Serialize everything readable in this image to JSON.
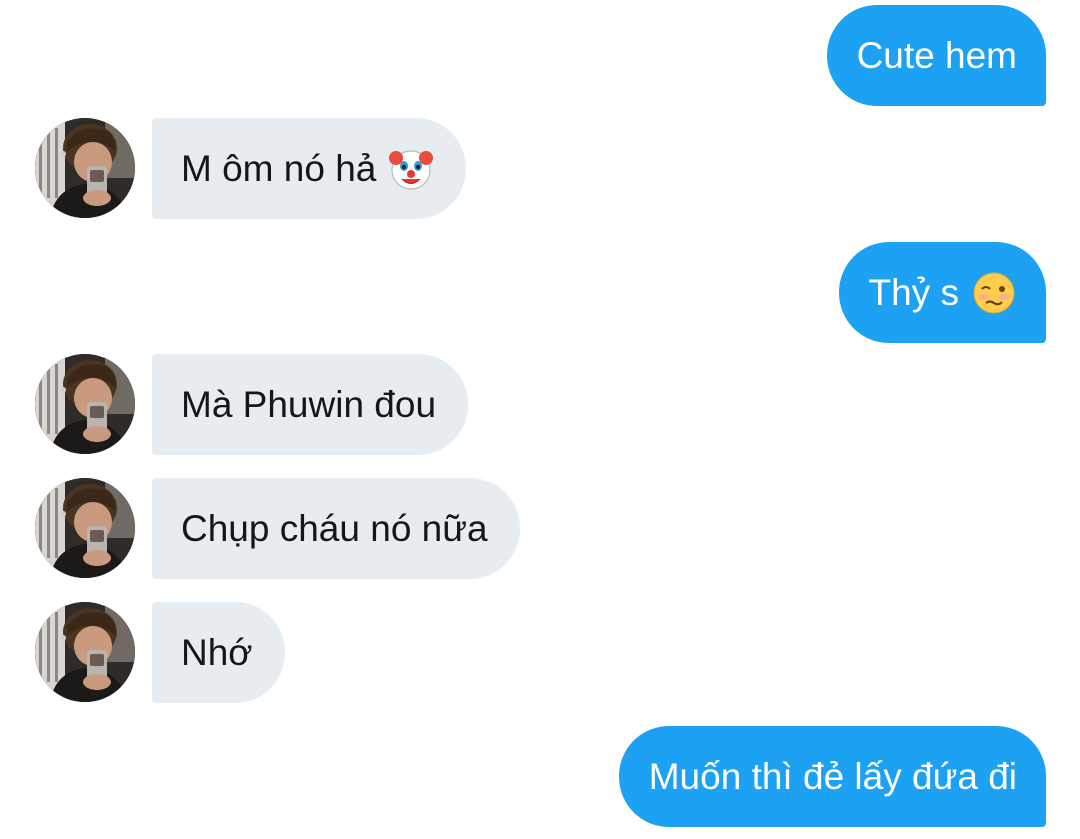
{
  "messages": [
    {
      "side": "out",
      "text": "Cute hem"
    },
    {
      "side": "in",
      "text": "M ôm nó hả",
      "emoji": "clown-face-icon"
    },
    {
      "side": "out",
      "text": "Thỷ s",
      "emoji": "woozy-face-icon"
    },
    {
      "side": "in",
      "text": "Mà Phuwin đou"
    },
    {
      "side": "in",
      "text": "Chụp cháu nó nữa"
    },
    {
      "side": "in",
      "text": "Nhớ"
    },
    {
      "side": "out",
      "text": "Muốn thì đẻ lấy đứa đi"
    }
  ],
  "colors": {
    "outgoing_bubble": "#1da1f2",
    "incoming_bubble": "#e6ecf0",
    "incoming_text": "#14171a",
    "outgoing_text": "#ffffff"
  }
}
